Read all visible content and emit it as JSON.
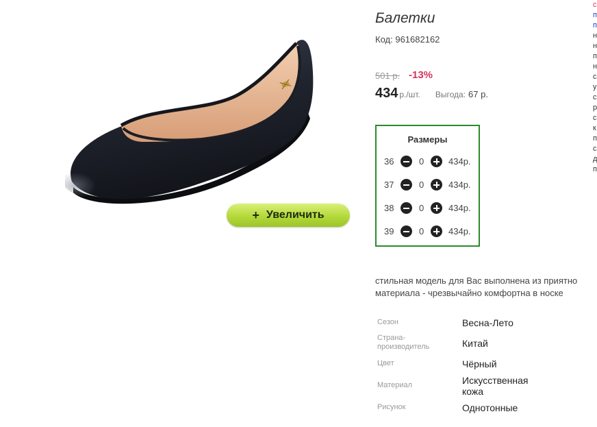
{
  "product": {
    "title": "Балетки",
    "code_label": "Код:",
    "code": "961682162"
  },
  "price": {
    "old": "501 р.",
    "discount": "-13%",
    "current": "434",
    "unit": "р./шт.",
    "savings_label": "Выгода:",
    "savings_value": "67 р."
  },
  "zoom_button": {
    "icon": "plus-icon",
    "label": "Увеличить"
  },
  "sizes": {
    "title": "Размеры",
    "rows": [
      {
        "size": "36",
        "qty": "0",
        "price": "434р."
      },
      {
        "size": "37",
        "qty": "0",
        "price": "434р."
      },
      {
        "size": "38",
        "qty": "0",
        "price": "434р."
      },
      {
        "size": "39",
        "qty": "0",
        "price": "434р."
      }
    ]
  },
  "description": {
    "line1": "стильная модель для Вас выполнена из приятно",
    "line2": "материала - чрезвычайно комфортна в носке"
  },
  "specs": [
    {
      "label": "Сезон",
      "value": "Весна-Лето"
    },
    {
      "label": "Страна-производитель",
      "value": "Китай"
    },
    {
      "label": "Цвет",
      "value": "Чёрный"
    },
    {
      "label": "Материал",
      "value": "Искусственная кожа"
    },
    {
      "label": "Рисунок",
      "value": "Однотонные"
    }
  ],
  "edge_letters": [
    "с",
    "п",
    "п",
    "н",
    "н",
    "п",
    "н",
    "с",
    "у",
    "с",
    "р",
    "с",
    "к",
    "п",
    "с",
    "д",
    "п"
  ],
  "colors": {
    "discount": "#d6345e",
    "sizes_border": "#2a8a2a",
    "zoom_button": "#b4d93a"
  }
}
